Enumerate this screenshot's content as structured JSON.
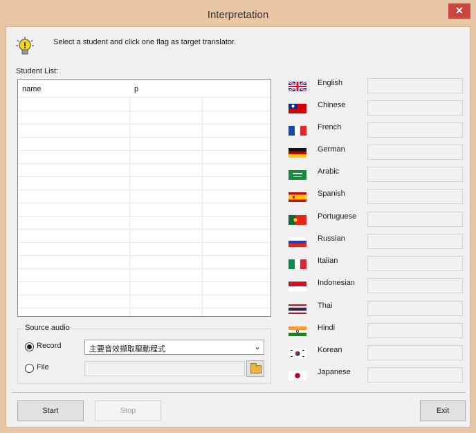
{
  "window": {
    "title": "Interpretation",
    "close_glyph": "✕"
  },
  "hint": {
    "text": "Select a student and click one flag as target translator.",
    "icon": "lightbulb-icon"
  },
  "student_list": {
    "label": "Student List:",
    "columns": [
      "name",
      "p"
    ]
  },
  "source_audio": {
    "legend": "Source audio",
    "record_label": "Record",
    "file_label": "File",
    "device_value": "主要音效擷取驅動程式",
    "selected": "record"
  },
  "languages": [
    {
      "label": "English",
      "flag": "uk-flag"
    },
    {
      "label": "Chinese",
      "flag": "taiwan-flag"
    },
    {
      "label": "French",
      "flag": "france-flag"
    },
    {
      "label": "German",
      "flag": "germany-flag"
    },
    {
      "label": "Arabic",
      "flag": "saudi-flag"
    },
    {
      "label": "Spanish",
      "flag": "spain-flag"
    },
    {
      "label": "Portuguese",
      "flag": "portugal-flag"
    },
    {
      "label": "Russian",
      "flag": "russia-flag"
    },
    {
      "label": "Italian",
      "flag": "italy-flag"
    },
    {
      "label": "Indonesian",
      "flag": "indonesia-flag"
    },
    {
      "label": "Thai",
      "flag": "thailand-flag"
    },
    {
      "label": "Hindi",
      "flag": "india-flag"
    },
    {
      "label": "Korean",
      "flag": "korea-flag"
    },
    {
      "label": "Japanese",
      "flag": "japan-flag"
    }
  ],
  "buttons": {
    "start": "Start",
    "stop": "Stop",
    "exit": "Exit"
  },
  "colors": {
    "titlebar": "#e9c6a6",
    "close": "#c9463d",
    "dialog": "#f0f0f0"
  }
}
